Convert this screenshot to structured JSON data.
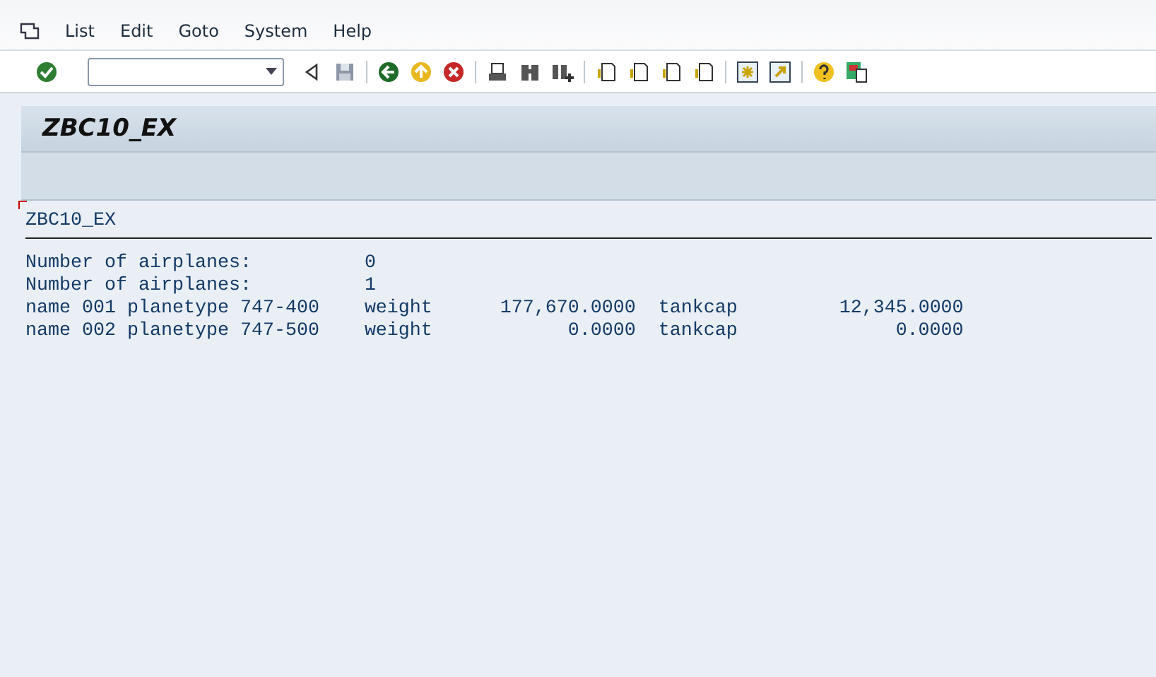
{
  "menu": [
    "List",
    "Edit",
    "Goto",
    "System",
    "Help"
  ],
  "title": "ZBC10_EX",
  "list": {
    "header": "ZBC10_EX",
    "rows": [
      {
        "kind": "count",
        "label": "Number of airplanes:",
        "value": "0"
      },
      {
        "kind": "count",
        "label": "Number of airplanes:",
        "value": "1"
      },
      {
        "kind": "plane",
        "label": "name 001 planetype 747-400",
        "weight_label": "weight",
        "weight": "177,670.0000",
        "tank_label": "tankcap",
        "tank": "12,345.0000"
      },
      {
        "kind": "plane",
        "label": "name 002 planetype 747-500",
        "weight_label": "weight",
        "weight": "0.0000",
        "tank_label": "tankcap",
        "tank": "0.0000"
      }
    ]
  }
}
